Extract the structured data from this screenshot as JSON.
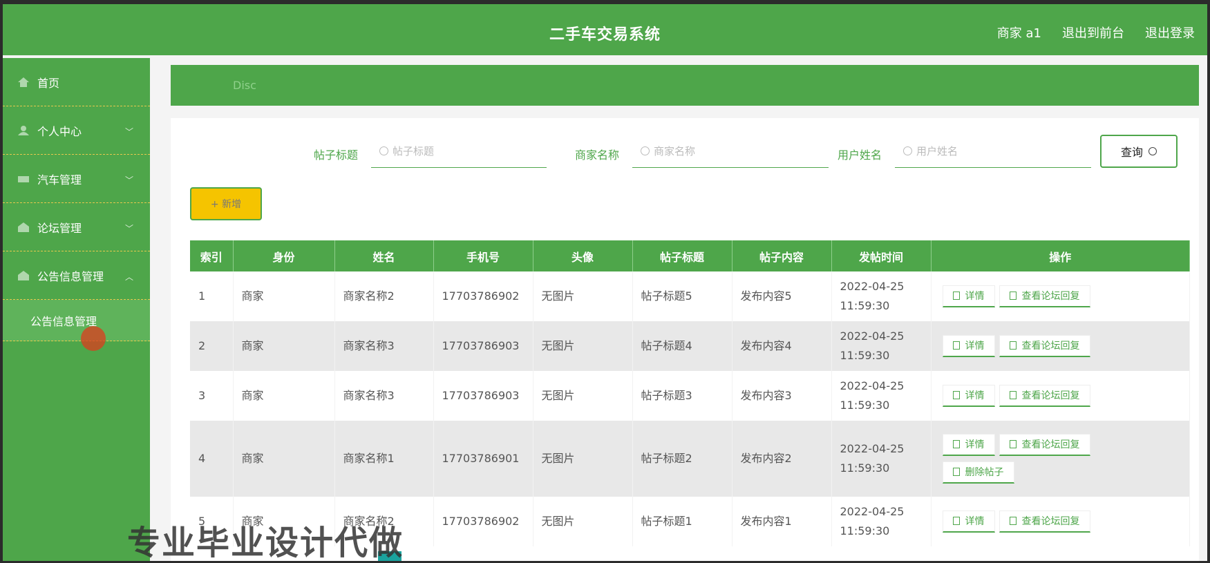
{
  "header": {
    "title": "二手车交易系统",
    "links": [
      "商家 a1",
      "退出到前台",
      "退出登录"
    ]
  },
  "sidebar": {
    "items": [
      {
        "label": "首页",
        "icon": "home-icon"
      },
      {
        "label": "个人中心",
        "icon": "user-icon"
      },
      {
        "label": "汽车管理",
        "icon": "car-icon"
      },
      {
        "label": "论坛管理",
        "icon": "forum-icon"
      },
      {
        "label": "公告信息管理",
        "icon": "notice-icon"
      }
    ],
    "sub_item": "公告信息管理"
  },
  "banner": {
    "text": "Disc"
  },
  "search": {
    "fields": [
      {
        "label": "帖子标题",
        "placeholder": "帖子标题"
      },
      {
        "label": "商家名称",
        "placeholder": "商家名称"
      },
      {
        "label": "用户姓名",
        "placeholder": "用户姓名"
      }
    ],
    "query_label": "查询"
  },
  "add_label": "+ 新增",
  "table": {
    "headers": [
      "索引",
      "身份",
      "姓名",
      "手机号",
      "头像",
      "帖子标题",
      "帖子内容",
      "发帖时间",
      "操作"
    ],
    "rows": [
      {
        "idx": "1",
        "role": "商家",
        "name": "商家名称2",
        "phone": "17703786902",
        "avatar": "无图片",
        "title": "帖子标题5",
        "content": "发布内容5",
        "time": "2022-04-25 11:59:30",
        "ops": [
          "详情",
          "查看论坛回复"
        ]
      },
      {
        "idx": "2",
        "role": "商家",
        "name": "商家名称3",
        "phone": "17703786903",
        "avatar": "无图片",
        "title": "帖子标题4",
        "content": "发布内容4",
        "time": "2022-04-25 11:59:30",
        "ops": [
          "详情",
          "查看论坛回复"
        ]
      },
      {
        "idx": "3",
        "role": "商家",
        "name": "商家名称3",
        "phone": "17703786903",
        "avatar": "无图片",
        "title": "帖子标题3",
        "content": "发布内容3",
        "time": "2022-04-25 11:59:30",
        "ops": [
          "详情",
          "查看论坛回复"
        ]
      },
      {
        "idx": "4",
        "role": "商家",
        "name": "商家名称1",
        "phone": "17703786901",
        "avatar": "无图片",
        "title": "帖子标题2",
        "content": "发布内容2",
        "time": "2022-04-25 11:59:30",
        "ops": [
          "详情",
          "查看论坛回复",
          "删除帖子"
        ]
      },
      {
        "idx": "5",
        "role": "商家",
        "name": "商家名称2",
        "phone": "17703786902",
        "avatar": "无图片",
        "title": "帖子标题1",
        "content": "发布内容1",
        "time": "2022-04-25 11:59:30",
        "ops": [
          "详情",
          "查看论坛回复"
        ]
      }
    ]
  },
  "watermark": "专业毕业设计代做",
  "colors": {
    "primary": "#4ea64a",
    "accent": "#f5c400"
  }
}
